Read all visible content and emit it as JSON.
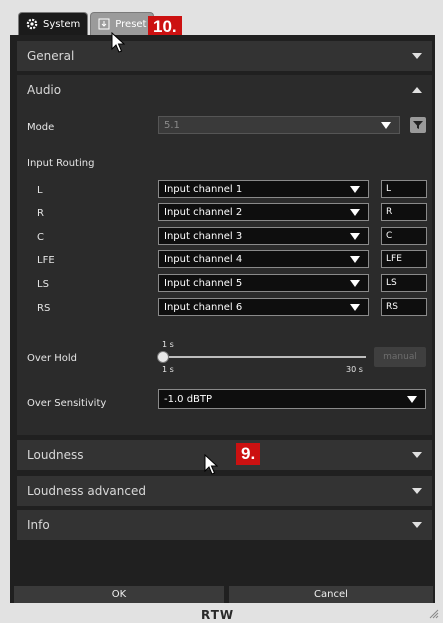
{
  "tabs": [
    {
      "label": "System",
      "icon": "gear-icon",
      "active": true
    },
    {
      "label": "Preset",
      "icon": "preset-icon",
      "active": false
    }
  ],
  "callouts": {
    "preset": "10.",
    "loudness": "9."
  },
  "sections": {
    "general": "General",
    "audio": "Audio",
    "loudness": "Loudness",
    "loudness_advanced": "Loudness advanced",
    "info": "Info"
  },
  "audio": {
    "mode_label": "Mode",
    "mode_value": "5.1",
    "input_routing_label": "Input Routing",
    "routing": [
      {
        "channel": "L",
        "input": "Input channel 1",
        "name": "L"
      },
      {
        "channel": "R",
        "input": "Input channel 2",
        "name": "R"
      },
      {
        "channel": "C",
        "input": "Input channel 3",
        "name": "C"
      },
      {
        "channel": "LFE",
        "input": "Input channel 4",
        "name": "LFE"
      },
      {
        "channel": "LS",
        "input": "Input channel 5",
        "name": "LS"
      },
      {
        "channel": "RS",
        "input": "Input channel 6",
        "name": "RS"
      }
    ],
    "over_hold_label": "Over Hold",
    "over_hold_value": "1 s",
    "over_hold_min": "1 s",
    "over_hold_max": "30 s",
    "over_hold_level": 0.0,
    "manual_label": "manual",
    "over_sensitivity_label": "Over Sensitivity",
    "over_sensitivity_value": "-1.0 dBTP"
  },
  "buttons": {
    "ok": "OK",
    "cancel": "Cancel"
  },
  "logo": "RTW"
}
